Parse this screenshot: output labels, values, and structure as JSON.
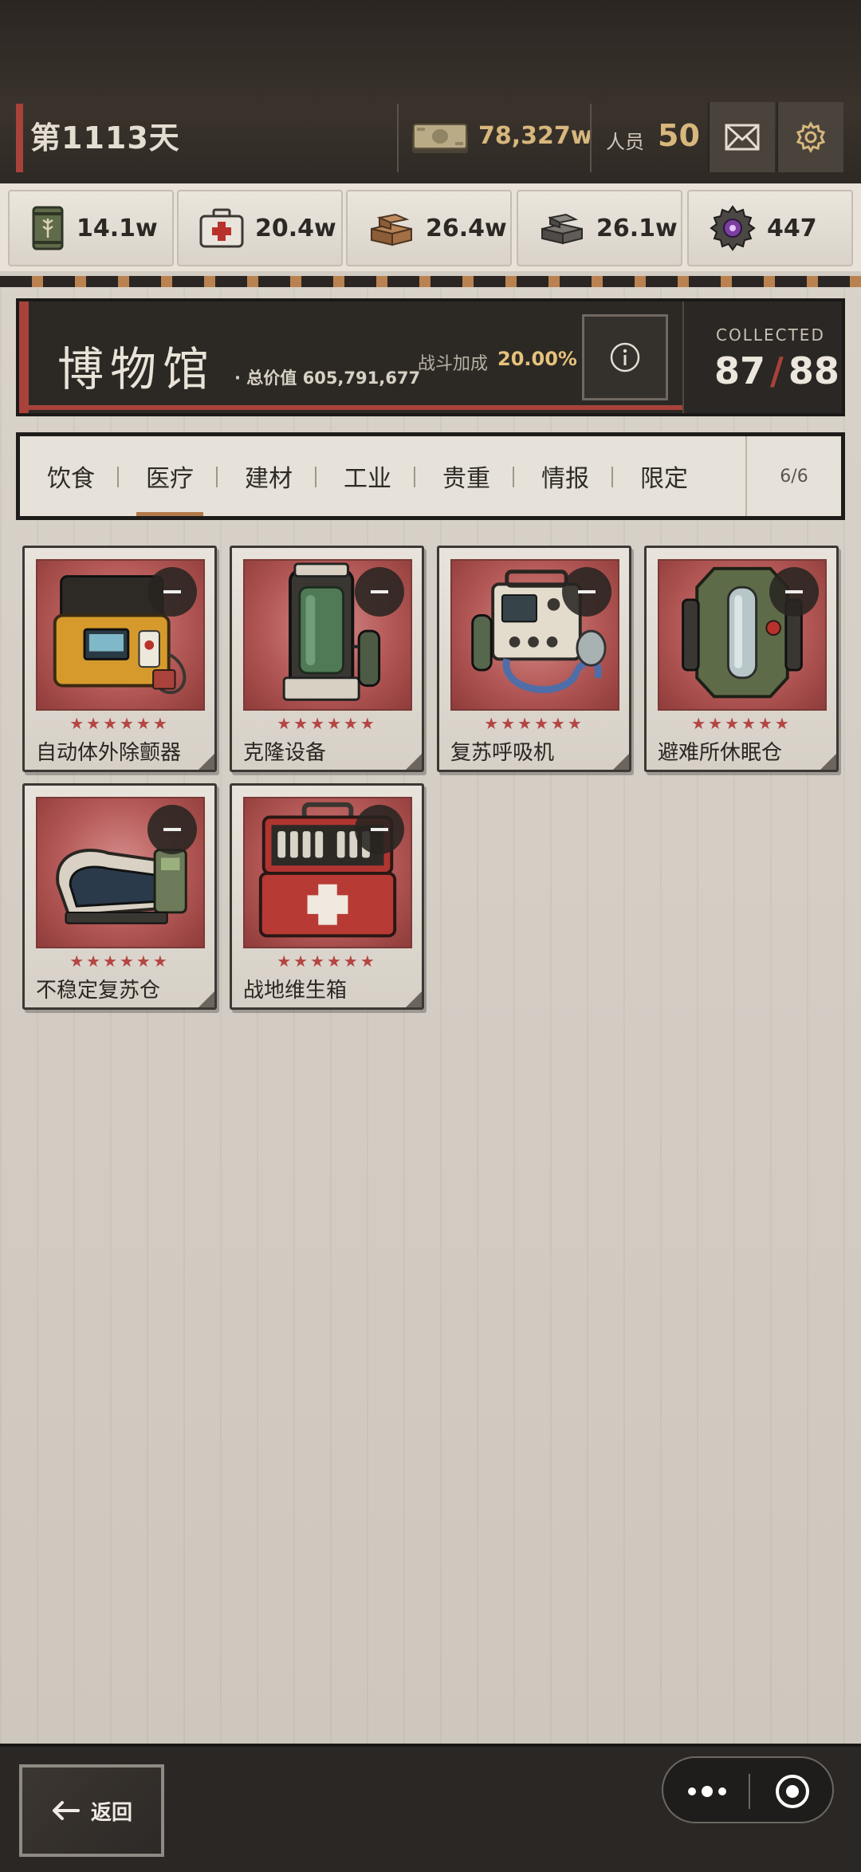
{
  "status_bar": {
    "day_label": "第1113天",
    "money_value": "78,327w",
    "staff_label": "人员",
    "staff_value": "50",
    "mail_icon": "mail-icon",
    "settings_icon": "gear-icon"
  },
  "resources": [
    {
      "icon": "food-can-icon",
      "value": "14.1w"
    },
    {
      "icon": "medkit-icon",
      "value": "20.4w"
    },
    {
      "icon": "wood-icon",
      "value": "26.4w"
    },
    {
      "icon": "metal-ingot-icon",
      "value": "26.1w"
    },
    {
      "icon": "gear-core-icon",
      "value": "447"
    }
  ],
  "museum": {
    "title": "博物馆",
    "total_value": "· 总价值 605,791,677",
    "boost_label": "战斗加成",
    "boost_value": "20.00%",
    "collected_label": "COLLECTED",
    "collected_count": "87",
    "collected_total": "88"
  },
  "tabs": {
    "items": [
      {
        "label": "饮食"
      },
      {
        "label": "医疗"
      },
      {
        "label": "建材"
      },
      {
        "label": "工业"
      },
      {
        "label": "贵重"
      },
      {
        "label": "情报"
      },
      {
        "label": "限定"
      }
    ],
    "active": "医疗",
    "count": "6/6"
  },
  "items": [
    {
      "name": "自动体外除颤器",
      "stars": "★★★★★★",
      "icon": "defibrillator-icon"
    },
    {
      "name": "克隆设备",
      "stars": "★★★★★★",
      "icon": "clone-tank-icon"
    },
    {
      "name": "复苏呼吸机",
      "stars": "★★★★★★",
      "icon": "ventilator-icon"
    },
    {
      "name": "避难所休眠仓",
      "stars": "★★★★★★",
      "icon": "sleep-pod-icon"
    },
    {
      "name": "不稳定复苏仓",
      "stars": "★★★★★★",
      "icon": "revival-bed-icon"
    },
    {
      "name": "战地维生箱",
      "stars": "★★★★★★",
      "icon": "field-medkit-icon"
    }
  ],
  "bottom": {
    "back_label": "返回"
  },
  "colors": {
    "accent_red": "#a8423a",
    "gold": "#d7b77c",
    "boost_gold": "#e6c27b"
  }
}
